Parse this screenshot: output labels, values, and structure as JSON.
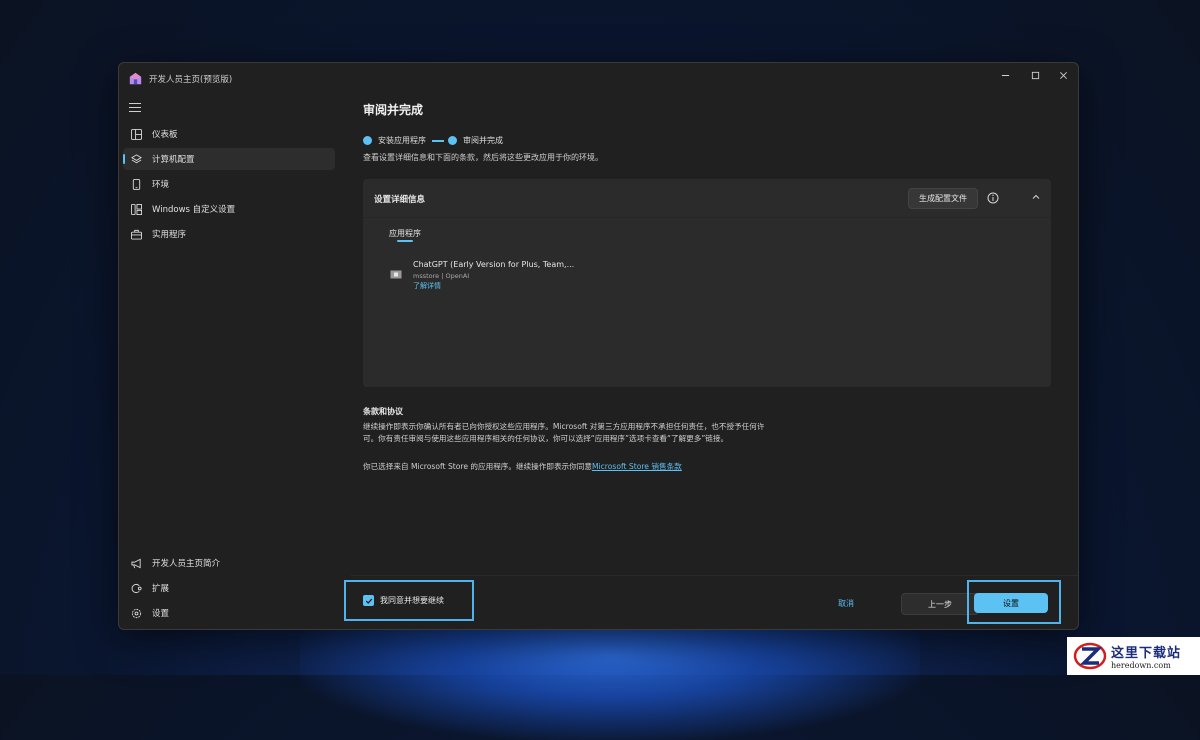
{
  "window": {
    "title": "开发人员主页(预览版)"
  },
  "sidebar": {
    "items": [
      {
        "label": "仪表板",
        "icon": "dashboard-icon",
        "active": false
      },
      {
        "label": "计算机配置",
        "icon": "layers-icon",
        "active": true
      },
      {
        "label": "环境",
        "icon": "device-icon",
        "active": false
      },
      {
        "label": "Windows 自定义设置",
        "icon": "windows-customize-icon",
        "active": false
      },
      {
        "label": "实用程序",
        "icon": "toolbox-icon",
        "active": false
      }
    ],
    "bottom_items": [
      {
        "label": "开发人员主页简介",
        "icon": "megaphone-icon"
      },
      {
        "label": "扩展",
        "icon": "puzzle-icon"
      },
      {
        "label": "设置",
        "icon": "gear-icon"
      }
    ]
  },
  "main": {
    "title": "审阅并完成",
    "steps": [
      "安装应用程序",
      "审阅并完成"
    ],
    "description": "查看设置详细信息和下面的条款，然后将这些更改应用于你的环境。",
    "details_card": {
      "title": "设置详细信息",
      "generate_button": "生成配置文件",
      "tab": "应用程序",
      "app": {
        "name": "ChatGPT (Early Version for Plus, Team,...",
        "meta": "msstore | OpenAI",
        "link": "了解详情"
      }
    },
    "terms": {
      "heading": "条款和协议",
      "paragraph1": "继续操作即表示你确认所有者已向你授权这些应用程序。Microsoft 对第三方应用程序不承担任何责任，也不授予任何许可。你有责任审阅与使用这些应用程序相关的任何协议，你可以选择“应用程序”选项卡查看“了解更多”链接。",
      "paragraph2_prefix": "你已选择来自 Microsoft Store 的应用程序。继续操作即表示你同意",
      "paragraph2_link": "Microsoft Store 销售条款"
    }
  },
  "footer": {
    "agree_label": "我同意并想要继续",
    "agree_checked": true,
    "cancel": "取消",
    "back": "上一步",
    "setup": "设置"
  },
  "watermark": {
    "cn": "这里下载站",
    "en": "heredown.com"
  },
  "colors": {
    "accent": "#5cc1f3",
    "window_bg": "#202020",
    "card_bg": "#2b2b2b"
  }
}
